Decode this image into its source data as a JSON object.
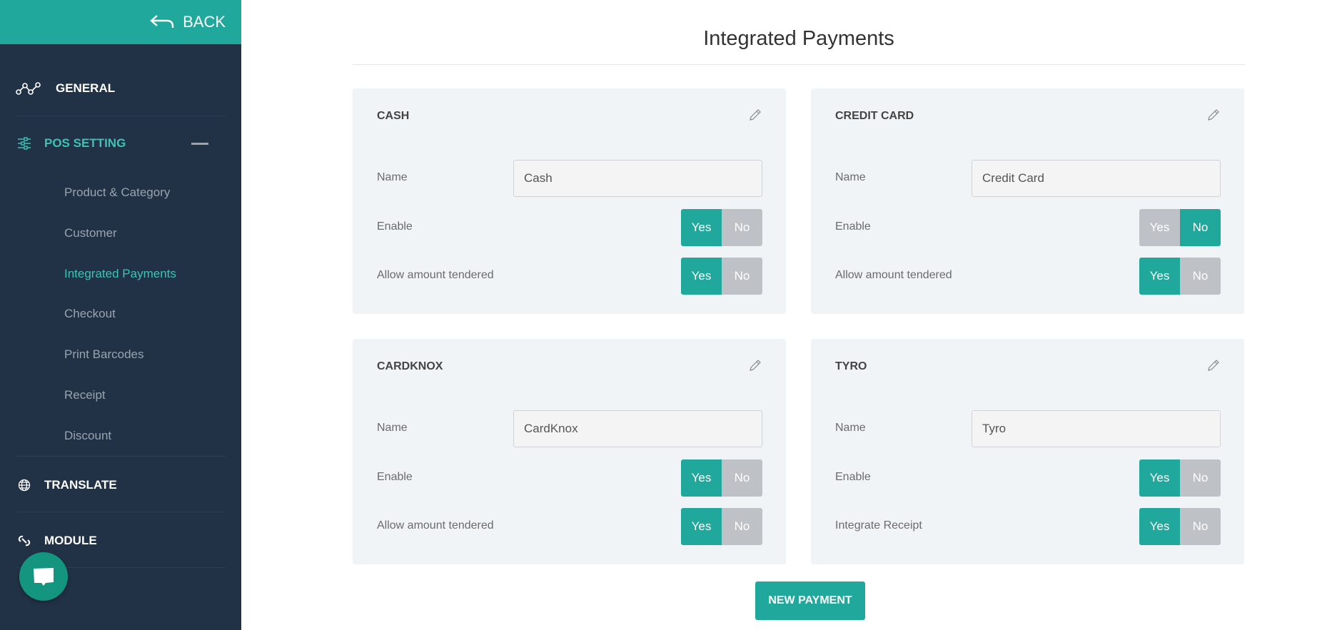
{
  "sidebar": {
    "back_label": "BACK",
    "general": "GENERAL",
    "pos_setting": "POS SETTING",
    "sub_items": [
      "Product & Category",
      "Customer",
      "Integrated Payments",
      "Checkout",
      "Print Barcodes",
      "Receipt",
      "Discount"
    ],
    "active_sub": "Integrated Payments",
    "translate": "TRANSLATE",
    "module": "MODULE"
  },
  "main": {
    "title": "Integrated Payments",
    "cards": [
      {
        "title": "CASH",
        "name_label": "Name",
        "name_value": "Cash",
        "rows": [
          {
            "label": "Enable",
            "value": "Yes"
          },
          {
            "label": "Allow amount tendered",
            "value": "Yes"
          }
        ]
      },
      {
        "title": "CREDIT CARD",
        "name_label": "Name",
        "name_value": "Credit Card",
        "rows": [
          {
            "label": "Enable",
            "value": "No"
          },
          {
            "label": "Allow amount tendered",
            "value": "Yes"
          }
        ]
      },
      {
        "title": "CARDKNOX",
        "name_label": "Name",
        "name_value": "CardKnox",
        "rows": [
          {
            "label": "Enable",
            "value": "Yes"
          },
          {
            "label": "Allow amount tendered",
            "value": "Yes"
          }
        ]
      },
      {
        "title": "TYRO",
        "name_label": "Name",
        "name_value": "Tyro",
        "rows": [
          {
            "label": "Enable",
            "value": "Yes"
          },
          {
            "label": "Integrate Receipt",
            "value": "Yes"
          }
        ]
      }
    ],
    "yes_label": "Yes",
    "no_label": "No",
    "new_payment_label": "NEW PAYMENT"
  },
  "colors": {
    "accent": "#20a89d",
    "sidebar": "#213247",
    "card": "#f1f4f7",
    "toggle_off": "#bec2c7"
  }
}
